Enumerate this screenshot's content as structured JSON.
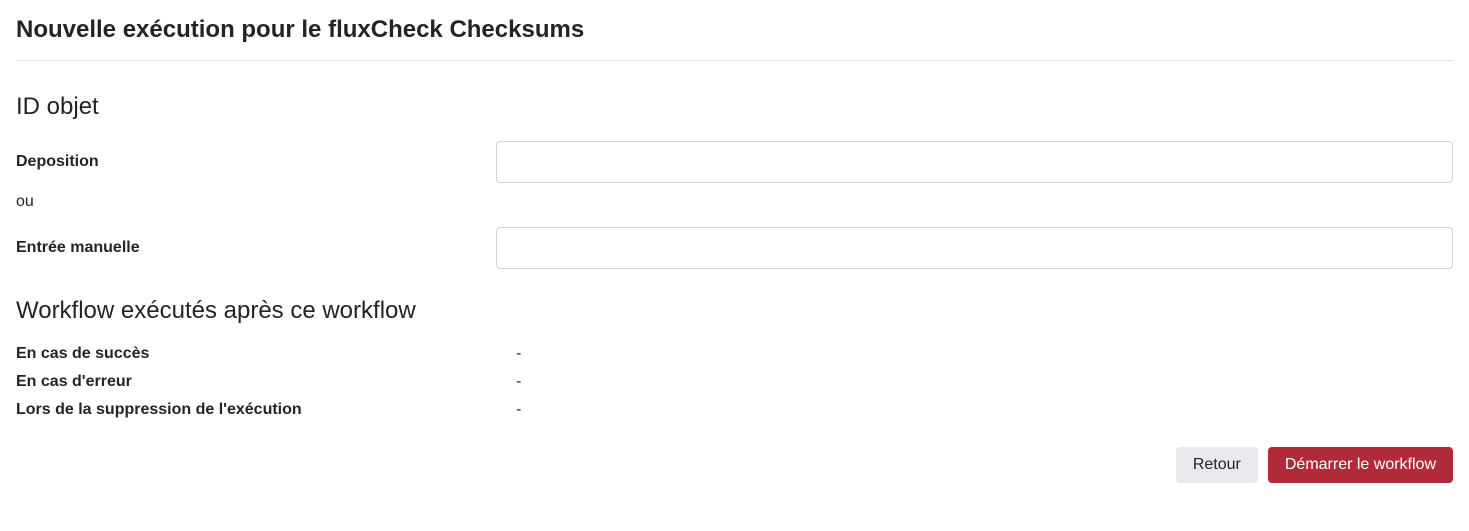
{
  "title": "Nouvelle exécution pour le fluxCheck Checksums",
  "section1": {
    "heading": "ID objet",
    "deposition_label": "Deposition",
    "or_text": "ou",
    "manual_label": "Entrée manuelle"
  },
  "section2": {
    "heading": "Workflow exécutés après ce workflow",
    "success_label": "En cas de succès",
    "success_value": "-",
    "error_label": "En cas d'erreur",
    "error_value": "-",
    "delete_label": "Lors de la suppression de l'exécution",
    "delete_value": "-"
  },
  "buttons": {
    "back": "Retour",
    "start": "Démarrer le workflow"
  }
}
